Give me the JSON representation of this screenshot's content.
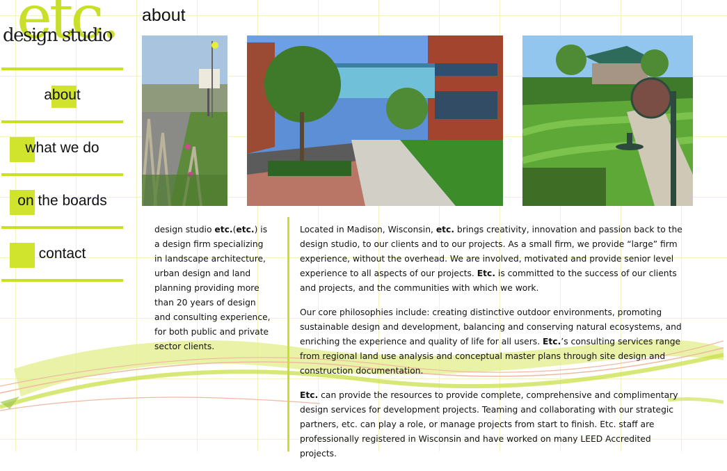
{
  "logo": {
    "mark": "etc.",
    "subtitle": "design studio"
  },
  "nav": [
    {
      "label": "about"
    },
    {
      "label": "what we do"
    },
    {
      "label": "on the boards"
    },
    {
      "label": "contact"
    }
  ],
  "page_title": "about",
  "photos": [
    {
      "alt": "street with ornamental grasses and welcome sign"
    },
    {
      "alt": "downtown street with skywalk and trees"
    },
    {
      "alt": "park path with lawn and lamp post"
    }
  ],
  "intro": {
    "t1": "design studio ",
    "b1": "etc.",
    "t2": "(",
    "b2": "etc.",
    "t3": ") is a design firm specializing in landscape architecture, urban design and land planning providing more than 20 years of design and consulting experience, for both public and private sector clients."
  },
  "body": {
    "p1": {
      "t1": "Located in Madison, Wisconsin, ",
      "b1": "etc.",
      "t2": " brings creativity, innovation and passion back to the design studio, to our clients and to our projects. As a small firm, we provide “large” firm experience, without the overhead. We are involved, motivated and provide senior level experience to all aspects of our projects. ",
      "b2": "Etc.",
      "t3": " is committed to the success of our clients and projects, and the communities with which we work."
    },
    "p2": {
      "t1": "Our core philosophies include: creating distinctive outdoor environments, promoting sustainable design and development, balancing and conserving natural ecosystems, and enriching the experience and quality of life for all users. ",
      "b1": "Etc.",
      "t2": "’s consulting services range from regional land use analysis and conceptual master plans through site design and construction documentation."
    },
    "p3": {
      "b1": "Etc.",
      "t1": " can provide the resources to provide complete, comprehensive and complimentary design services for development projects. Teaming and collaborating with our strategic partners, etc. can play a role, or manage projects from start to finish. Etc. staff are professionally registered in Wisconsin and have worked on many LEED Accredited projects."
    }
  },
  "colors": {
    "accent": "#c9df2a",
    "grid": "#f3f3bf"
  }
}
